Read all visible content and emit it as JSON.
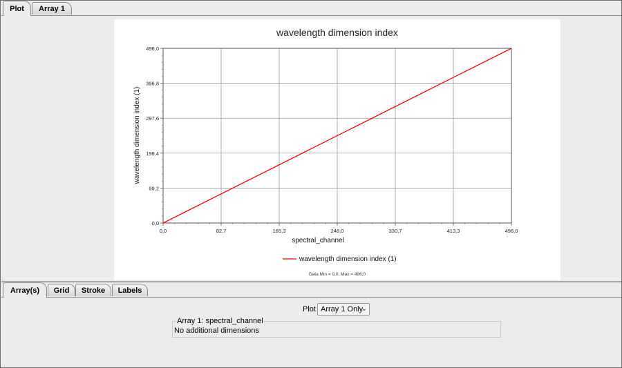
{
  "top_tabs": [
    {
      "label": "Plot",
      "active": true
    },
    {
      "label": "Array 1",
      "active": false
    }
  ],
  "bottom_tabs": [
    {
      "label": "Array(s)",
      "active": true
    },
    {
      "label": "Grid",
      "active": false
    },
    {
      "label": "Stroke",
      "active": false
    },
    {
      "label": "Labels",
      "active": false
    }
  ],
  "chart_data": {
    "type": "line",
    "title": "wavelength dimension index",
    "xlabel": "spectral_channel",
    "ylabel": "wavelength dimension index (1)",
    "xlim": [
      0,
      496
    ],
    "ylim": [
      0,
      496
    ],
    "x_ticks": [
      "0,0",
      "82,7",
      "165,3",
      "248,0",
      "330,7",
      "413,3",
      "496,0"
    ],
    "y_ticks": [
      "0,0",
      "99,2",
      "198,4",
      "297,6",
      "396,8",
      "496,0"
    ],
    "grid": true,
    "legend_position": "bottom",
    "series": [
      {
        "name": "wavelength dimension index (1)",
        "color": "#ff0000",
        "x": [
          0,
          496
        ],
        "y": [
          0,
          496
        ]
      }
    ],
    "footer": "Data Min = 0,0, Max = 496,0"
  },
  "controls": {
    "plot_label": "Plot",
    "plot_select_value": "Array 1 Only",
    "array_group_title": "Array 1: spectral_channel",
    "array_group_content": "No additional dimensions"
  }
}
